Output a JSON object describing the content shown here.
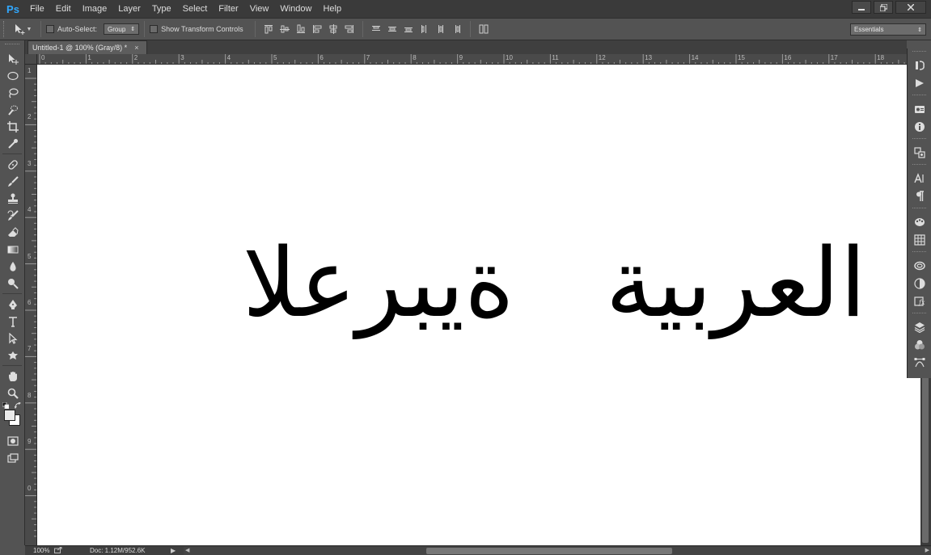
{
  "app": {
    "logo": "Ps",
    "menu": [
      "File",
      "Edit",
      "Image",
      "Layer",
      "Type",
      "Select",
      "Filter",
      "View",
      "Window",
      "Help"
    ]
  },
  "options_bar": {
    "auto_select_label": "Auto-Select:",
    "auto_select_checked": false,
    "auto_select_target": "Group",
    "show_transform_label": "Show Transform Controls",
    "show_transform_checked": false,
    "workspace": "Essentials"
  },
  "document": {
    "tab_title": "Untitled-1 @ 100% (Gray/8) *",
    "tab_close": "×",
    "canvas_text": "العربية   ةيبرعلا"
  },
  "rulers": {
    "horizontal_labels": [
      "0",
      "1",
      "2",
      "3",
      "4",
      "5",
      "6",
      "7",
      "8",
      "9",
      "10",
      "11",
      "12",
      "13",
      "14",
      "15",
      "16",
      "17",
      "18"
    ],
    "vertical_labels": [
      "1",
      "2",
      "3",
      "4",
      "5",
      "6",
      "7",
      "8",
      "9",
      "0"
    ]
  },
  "status_bar": {
    "zoom": "100%",
    "doc_info": "Doc: 1.12M/952.6K",
    "arrow": "▶"
  },
  "colors": {
    "accent": "#31a8ff",
    "foreground_swatch": "#eaeaea",
    "background_swatch": "#ffffff"
  },
  "icons": {
    "toolbar": [
      "move-tool-icon",
      "elliptical-marquee-icon",
      "lasso-icon",
      "quick-selection-icon",
      "crop-icon",
      "eyedropper-icon",
      "spot-healing-icon",
      "brush-icon",
      "clone-stamp-icon",
      "history-brush-icon",
      "eraser-icon",
      "gradient-icon",
      "blur-icon",
      "dodge-icon",
      "pen-icon",
      "type-icon",
      "path-selection-icon",
      "custom-shape-icon",
      "hand-icon",
      "zoom-icon"
    ],
    "panel_dock": [
      "history-icon",
      "actions-icon",
      "properties-icon",
      "info-icon",
      "clone-source-icon",
      "character-icon",
      "paragraph-icon",
      "color-icon",
      "swatches-icon",
      "libraries-icon",
      "adjustments-icon",
      "styles-icon",
      "layers-icon",
      "channels-icon",
      "paths-icon"
    ]
  }
}
